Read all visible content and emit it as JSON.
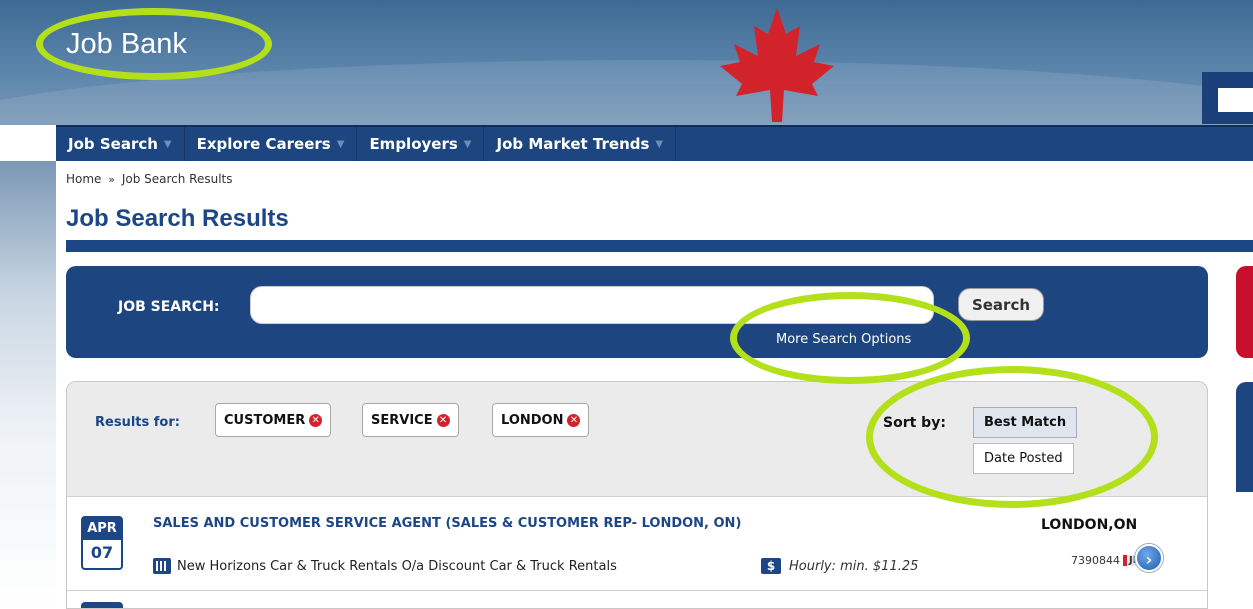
{
  "site": {
    "title": "Job Bank"
  },
  "nav": {
    "items": [
      {
        "label": "Job Search"
      },
      {
        "label": "Explore Careers"
      },
      {
        "label": "Employers"
      },
      {
        "label": "Job Market Trends"
      }
    ]
  },
  "breadcrumb": {
    "home": "Home",
    "current": "Job Search Results"
  },
  "page": {
    "title": "Job Search Results"
  },
  "search": {
    "label": "JOB SEARCH:",
    "value": "",
    "button_label": "Search",
    "more_options": "More Search Options"
  },
  "results": {
    "results_for_label": "Results for:",
    "filters": [
      {
        "label": "CUSTOMER"
      },
      {
        "label": "SERVICE"
      },
      {
        "label": "LONDON"
      }
    ],
    "sort_label": "Sort by:",
    "sort_options": [
      {
        "label": "Best Match",
        "active": true
      },
      {
        "label": "Date Posted",
        "active": false
      }
    ],
    "jobs": [
      {
        "month": "APR",
        "day": "07",
        "title": "SALES AND CUSTOMER SERVICE AGENT (SALES & CUSTOMER REP- LONDON, ON)",
        "employer": "New Horizons Car & Truck Rentals O/a Discount Car & Truck Rentals",
        "wage": "Hourly: min. $11.25",
        "location": "LONDON,ON",
        "job_id": "7390844",
        "source_badge": "JB"
      }
    ]
  },
  "icons": {
    "remove_filter": "close-circle-icon",
    "wage": "dollar-icon",
    "employer": "building-icon",
    "go": "chevron-right-circle-icon",
    "nav_caret": "caret-down-icon"
  },
  "colors": {
    "brand_blue": "#1c4685",
    "highlight_circle": "#b3e01b",
    "remove_red": "#d2232a"
  }
}
